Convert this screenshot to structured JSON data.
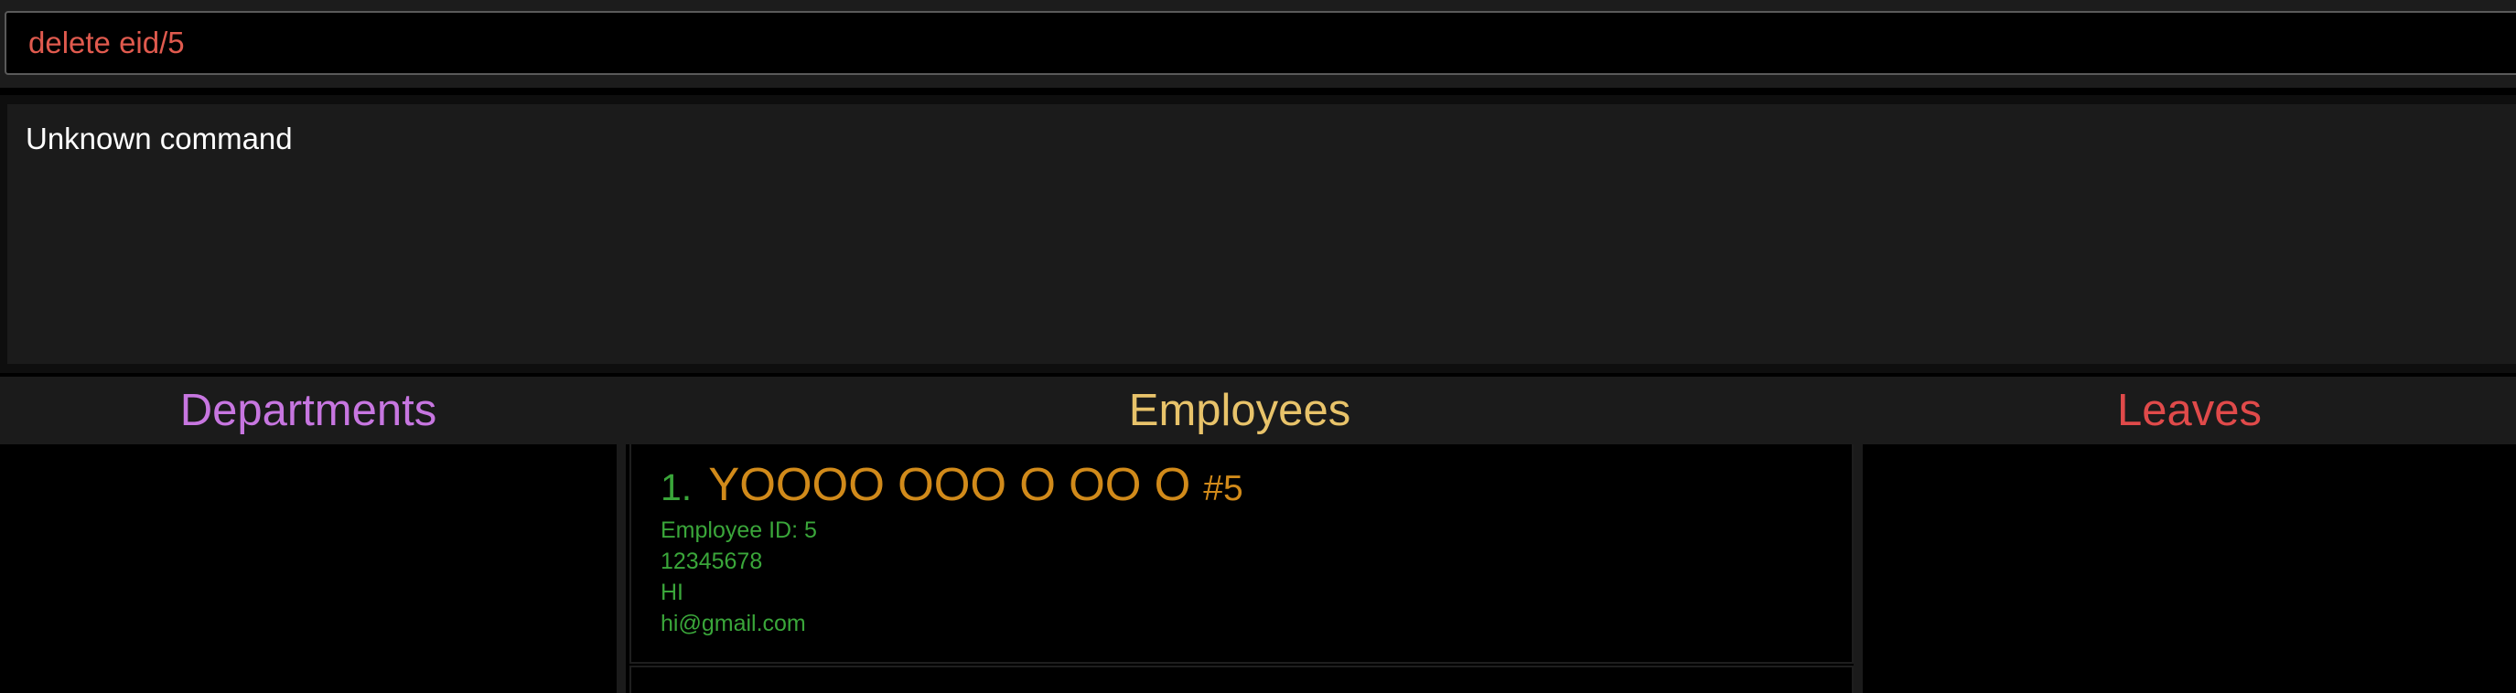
{
  "command": {
    "value": "delete eid/5"
  },
  "result": {
    "message": "Unknown command"
  },
  "panels": {
    "departments": {
      "title": "Departments"
    },
    "employees": {
      "title": "Employees"
    },
    "leaves": {
      "title": "Leaves"
    }
  },
  "employees": [
    {
      "index": "1.",
      "name": "YOOOO OOO  O OO O",
      "tag": "#5",
      "employee_id": "Employee ID: 5",
      "phone": "12345678",
      "address": "HI",
      "email": "hi@gmail.com"
    }
  ],
  "colors": {
    "command_text": "#e05a4e",
    "departments_title": "#c776e0",
    "employees_title": "#e8c36a",
    "leaves_title": "#e04a4a",
    "employee_name": "#d18a1a",
    "employee_details": "#3aa63a"
  }
}
